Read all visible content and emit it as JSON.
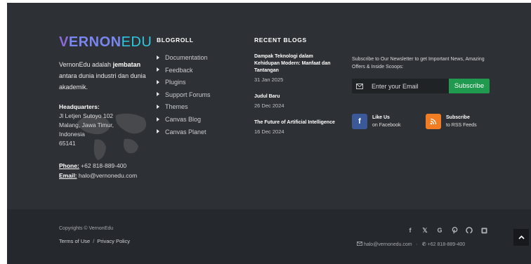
{
  "brand": {
    "logo_v": "V",
    "logo_ernon": "ERNON",
    "logo_edu": "EDU"
  },
  "about": {
    "text_before": "VernonEdu adalah ",
    "text_bold": "jembatan",
    "text_after": " antara dunia industri dan dunia akademik."
  },
  "headquarters": {
    "label": "Headquarters:",
    "line1": "Jl Letjen Sutoyo 102",
    "line2": "Malang, Jawa Timur,",
    "line3": "Indonesia",
    "line4": "65141"
  },
  "contact": {
    "phone_label": "Phone:",
    "phone": " +62 818-889-400",
    "email_label": "Email:",
    "email": " halo@vernonedu.com"
  },
  "blogroll": {
    "heading": "BLOGROLL",
    "items": [
      "Documentation",
      "Feedback",
      "Plugins",
      "Support Forums",
      "Themes",
      "Canvas Blog",
      "Canvas Planet"
    ]
  },
  "recent": {
    "heading": "RECENT BLOGS",
    "posts": [
      {
        "title": "Dampak Teknologi dalam Kehidupan Modern: Manfaat dan Tantangan",
        "date": "31 Jan 2025"
      },
      {
        "title": "Judul Baru",
        "date": "26 Dec 2024"
      },
      {
        "title": "The Future of Artificial Intelligence",
        "date": "16 Dec 2024"
      }
    ]
  },
  "newsletter": {
    "text": "Subscribe to Our Newsletter to get Important News, Amazing Offers & Inside Scoops:",
    "placeholder": "Enter your Email",
    "button": "Subscribe"
  },
  "social": {
    "facebook": {
      "title": "Like Us",
      "subtitle": "on Facebook"
    },
    "rss": {
      "title": "Subscribe",
      "subtitle": "to RSS Feeds"
    }
  },
  "footer": {
    "copyright": "Copyrights © VernonEdu",
    "terms": "Terms of Use",
    "separator": "/",
    "privacy": "Privacy Policy",
    "email": "halo@vernonedu.com",
    "dot": "·",
    "phone": "+62 818-889-400"
  },
  "colors": {
    "background": "#2d3034",
    "bottom_bar": "#25282c",
    "subscribe_button": "#1f9a4e",
    "facebook": "#3b5998",
    "rss": "#f07d24",
    "logo_accent": "#2ec6e0"
  },
  "icons": [
    "facebook-icon",
    "x-icon",
    "google-icon",
    "pinterest-icon",
    "github-icon",
    "rss-icon",
    "mail-icon",
    "phone-icon",
    "chevron-up-icon"
  ]
}
